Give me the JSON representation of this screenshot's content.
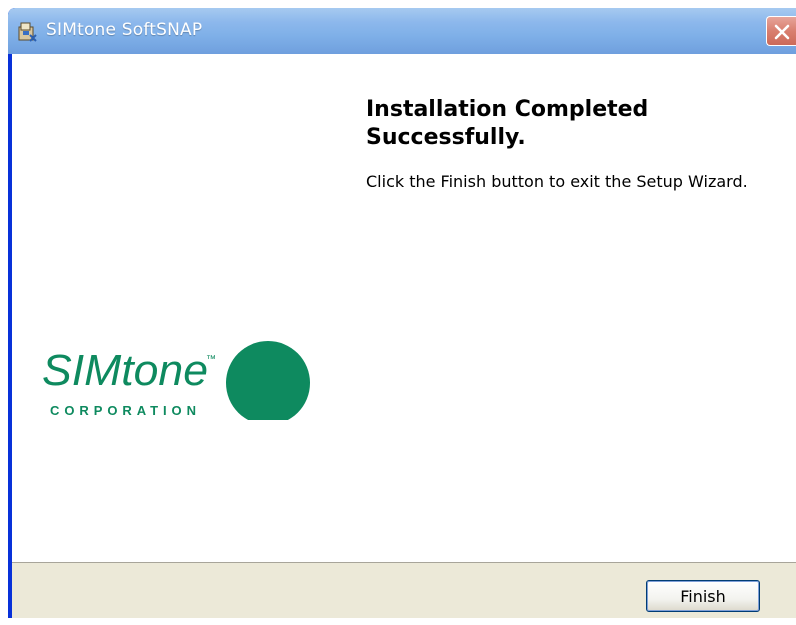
{
  "window": {
    "title": "SIMtone SoftSNAP",
    "icon": "installer-package-icon",
    "close_icon": "close-icon",
    "close_color": "#d97f6f"
  },
  "main": {
    "heading_line1": "Installation Completed",
    "heading_line2": "Successfully.",
    "message": "Click the Finish button to exit the Setup Wizard."
  },
  "logo": {
    "wordmark": "SIMtone",
    "trademark": "™",
    "tagline": "CORPORATION",
    "color": "#0e8a5f"
  },
  "footer": {
    "finish_label": "Finish"
  }
}
